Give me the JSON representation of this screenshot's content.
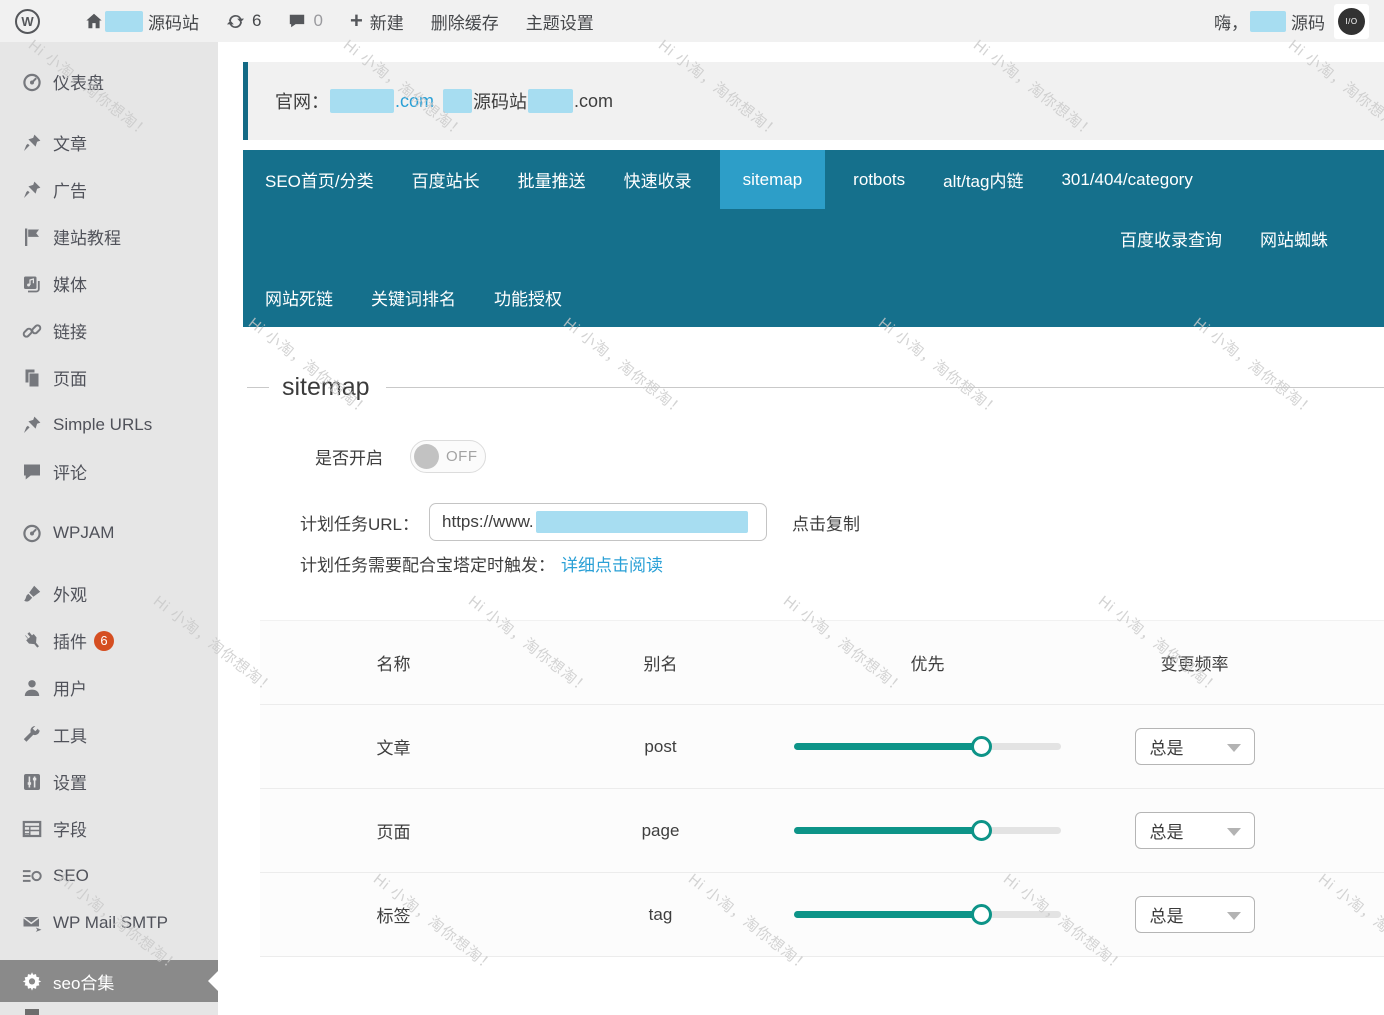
{
  "topbar": {
    "logo_letter": "W",
    "site_name": "源码站",
    "updates_count": "6",
    "comments_count": "0",
    "new_label": "新建",
    "clear_cache_label": "删除缓存",
    "theme_settings_label": "主题设置",
    "greeting": "嗨，",
    "username": "源码",
    "avatar_text": "I/O"
  },
  "sidebar": {
    "items": [
      {
        "label": "仪表盘",
        "icon": "gauge-icon",
        "slug": "dashboard"
      },
      {
        "label": "文章",
        "icon": "pin-icon",
        "slug": "posts",
        "section_gap": true
      },
      {
        "label": "广告",
        "icon": "pin-icon",
        "slug": "ads"
      },
      {
        "label": "建站教程",
        "icon": "flag-icon",
        "slug": "tutorials"
      },
      {
        "label": "媒体",
        "icon": "media-icon",
        "slug": "media"
      },
      {
        "label": "链接",
        "icon": "link-icon",
        "slug": "links"
      },
      {
        "label": "页面",
        "icon": "pages-icon",
        "slug": "pages"
      },
      {
        "label": "Simple URLs",
        "icon": "pin-icon",
        "slug": "simple-urls"
      },
      {
        "label": "评论",
        "icon": "comment-icon",
        "slug": "comments"
      },
      {
        "label": "WPJAM",
        "icon": "gauge-icon",
        "slug": "wpjam",
        "section_gap": true
      },
      {
        "label": "外观",
        "icon": "brush-icon",
        "slug": "appearance",
        "section_gap": true
      },
      {
        "label": "插件",
        "icon": "plugin-icon",
        "slug": "plugins",
        "badge": "6"
      },
      {
        "label": "用户",
        "icon": "user-icon",
        "slug": "users"
      },
      {
        "label": "工具",
        "icon": "wrench-icon",
        "slug": "tools"
      },
      {
        "label": "设置",
        "icon": "settings-icon",
        "slug": "settings"
      },
      {
        "label": "字段",
        "icon": "fields-icon",
        "slug": "fields"
      },
      {
        "label": "SEO",
        "icon": "seo-icon",
        "slug": "seo"
      },
      {
        "label": "WP Mail SMTP",
        "icon": "mail-icon",
        "slug": "wp-mail-smtp"
      },
      {
        "label": "seo合集",
        "icon": "gear-icon",
        "slug": "seo-collection",
        "active": true,
        "section_gap": true
      }
    ]
  },
  "notice": {
    "prefix": "官网：",
    "link_suffix": ".com",
    "site_label": "源码站",
    "plain_suffix": ".com"
  },
  "nav": {
    "rows": [
      [
        {
          "label": "SEO首页/分类",
          "slug": "seo-home-category"
        },
        {
          "label": "百度站长",
          "slug": "baidu-webmaster"
        },
        {
          "label": "批量推送",
          "slug": "batch-push"
        },
        {
          "label": "快速收录",
          "slug": "quick-include"
        },
        {
          "label": "sitemap",
          "slug": "sitemap",
          "active": true
        },
        {
          "label": "rotbots",
          "slug": "rotbots"
        },
        {
          "label": "alt/tag内链",
          "slug": "alt-tag-internal-links"
        },
        {
          "label": "301/404/category",
          "slug": "301-404-category"
        }
      ],
      [
        {
          "label": "百度收录查询",
          "slug": "baidu-include-query"
        },
        {
          "label": "网站蜘蛛",
          "slug": "site-spider"
        }
      ],
      [
        {
          "label": "网站死链",
          "slug": "dead-links"
        },
        {
          "label": "关键词排名",
          "slug": "keyword-ranking"
        },
        {
          "label": "功能授权",
          "slug": "feature-authorization"
        }
      ]
    ]
  },
  "section": {
    "title": "sitemap",
    "toggle_label": "是否开启",
    "toggle_state": "OFF",
    "url_label": "计划任务URL：",
    "url_value": "https://www.",
    "copy_label": "点击复制",
    "note_text": "计划任务需要配合宝塔定时触发：",
    "note_link": "详细点击阅读"
  },
  "table": {
    "headers": [
      "名称",
      "别名",
      "优先",
      "变更频率"
    ],
    "rows": [
      {
        "name": "文章",
        "alias": "post",
        "priority_pct": 70,
        "frequency": "总是"
      },
      {
        "name": "页面",
        "alias": "page",
        "priority_pct": 70,
        "frequency": "总是"
      },
      {
        "name": "标签",
        "alias": "tag",
        "priority_pct": 70,
        "frequency": "总是"
      }
    ]
  },
  "watermark": {
    "text": "Hi 小淘，淘你想淘！"
  },
  "colors": {
    "topbar_bg": "#f1f1f1",
    "sidebar_bg": "#e6e6e6",
    "sidebar_active_bg": "#8a8a8a",
    "badge_orange": "#d54e21",
    "nav_bg": "#15708c",
    "nav_active_bg": "#2d9ec8",
    "notice_border_teal": "#136a85",
    "link_blue": "#2aa0d6",
    "redaction_blue": "#a7ddf1",
    "slider_fill_teal": "#0d9488"
  }
}
